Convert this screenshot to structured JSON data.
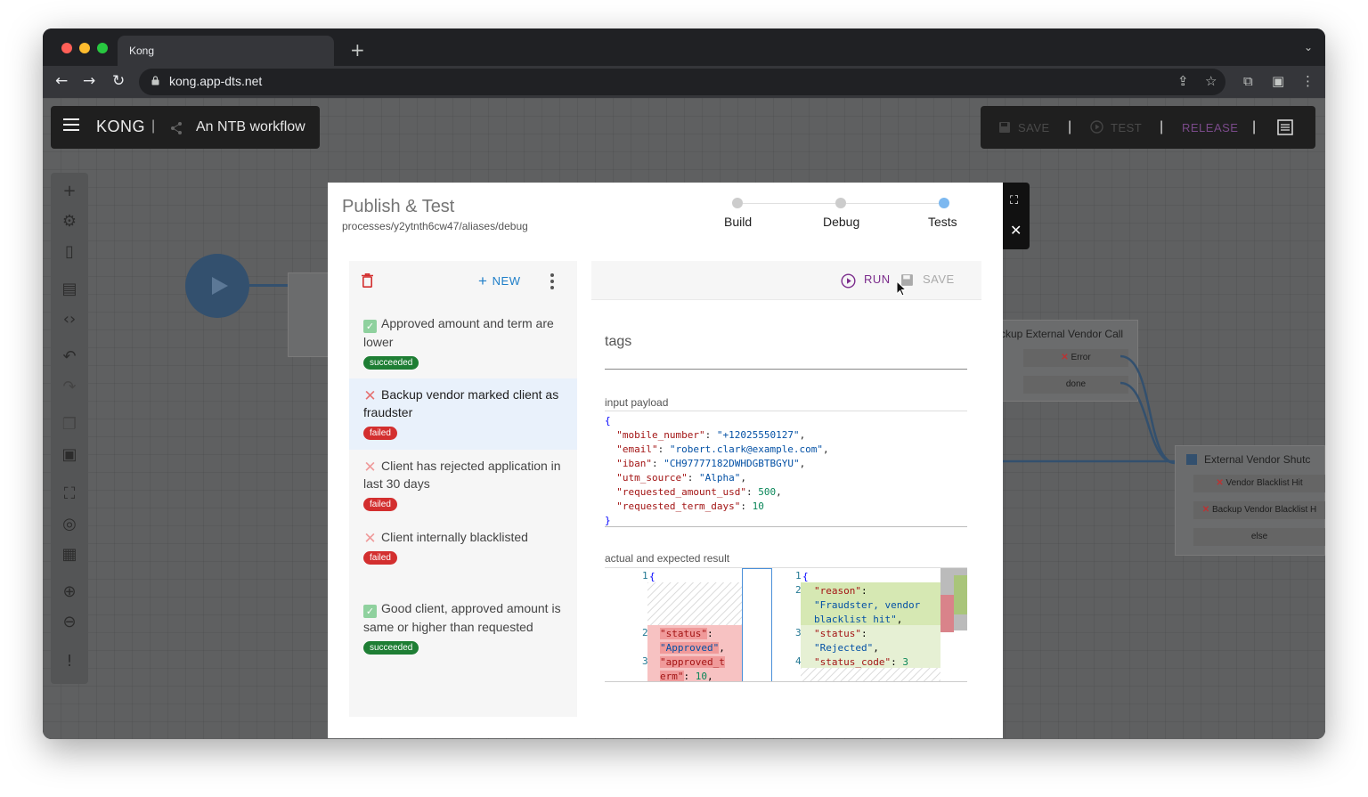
{
  "browser": {
    "tab_title": "Kong",
    "url": "kong.app-dts.net",
    "new_tab_symbol": "+",
    "tab_menu_symbol": "⌄"
  },
  "appbar": {
    "brand": "KONG",
    "workflow_name": "An NTB workflow",
    "save_label": "SAVE",
    "test_label": "TEST",
    "release_label": "RELEASE"
  },
  "canvas": {
    "node_backup_title": "ckup External Vendor Call",
    "node_backup_ports": [
      "Error",
      "done"
    ],
    "node_external_title": "External Vendor Shutc",
    "node_external_ports": [
      "Vendor Blacklist Hit",
      "Backup Vendor Blacklist H",
      "else"
    ]
  },
  "modal": {
    "title": "Publish & Test",
    "path": "processes/y2ytnth6cw47/aliases/debug",
    "steps": [
      "Build",
      "Debug",
      "Tests"
    ],
    "new_label": "NEW",
    "run_label": "RUN",
    "save_label": "SAVE",
    "tags_label": "tags",
    "input_payload_label": "input payload",
    "result_label": "actual and expected result"
  },
  "tests": [
    {
      "name": "Approved amount and term are lower",
      "status": "succeeded"
    },
    {
      "name": "Backup vendor marked client as fraudster",
      "status": "failed"
    },
    {
      "name": "Client has rejected application in last 30 days",
      "status": "failed"
    },
    {
      "name": "Client internally blacklisted",
      "status": "failed"
    },
    {
      "name": "Good client, approved amount is same or higher than requested",
      "status": "succeeded"
    }
  ],
  "payload": {
    "mobile_number": "+12025550127",
    "email": "robert.clark@example.com",
    "iban": "CH97777182DWHDGBTBGYU",
    "utm_source": "Alpha",
    "requested_amount_usd": 500,
    "requested_term_days": 10
  },
  "colors": {
    "succeeded": "#1e7e34",
    "failed": "#d32f2f",
    "accent": "#1e7ec8",
    "run": "#7b2c8c"
  }
}
